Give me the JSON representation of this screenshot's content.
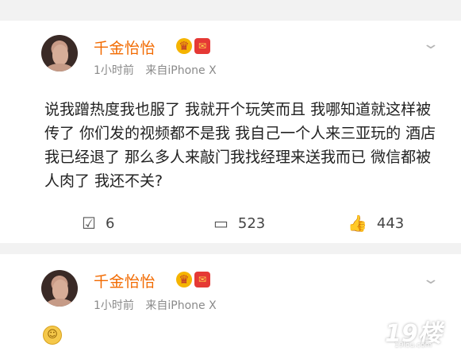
{
  "posts": [
    {
      "username": "千金怡怡",
      "time": "1小时前",
      "source": "来自iPhone X",
      "text": "说我蹭热度我也服了 我就开个玩笑而且 我哪知道就这样被传了 你们发的视频都不是我 我自己一个人来三亚玩的 酒店我已经退了 那么多人来敲门我找经理来送我而已 微信都被人肉了 我还不关?",
      "repost_count": "6",
      "comment_count": "523",
      "like_count": "443"
    },
    {
      "username": "千金怡怡",
      "time": "1小时前",
      "source": "来自iPhone X"
    }
  ],
  "watermark": {
    "logo": "19楼",
    "domain": "19lou.com"
  },
  "colors": {
    "username": "#f26a00",
    "meta": "#8a8a8a",
    "background": "#f2f2f2"
  },
  "icons": {
    "repost": "repost-icon",
    "comment": "comment-icon",
    "like": "thumbs-up-icon",
    "chevron": "chevron-down-icon"
  }
}
